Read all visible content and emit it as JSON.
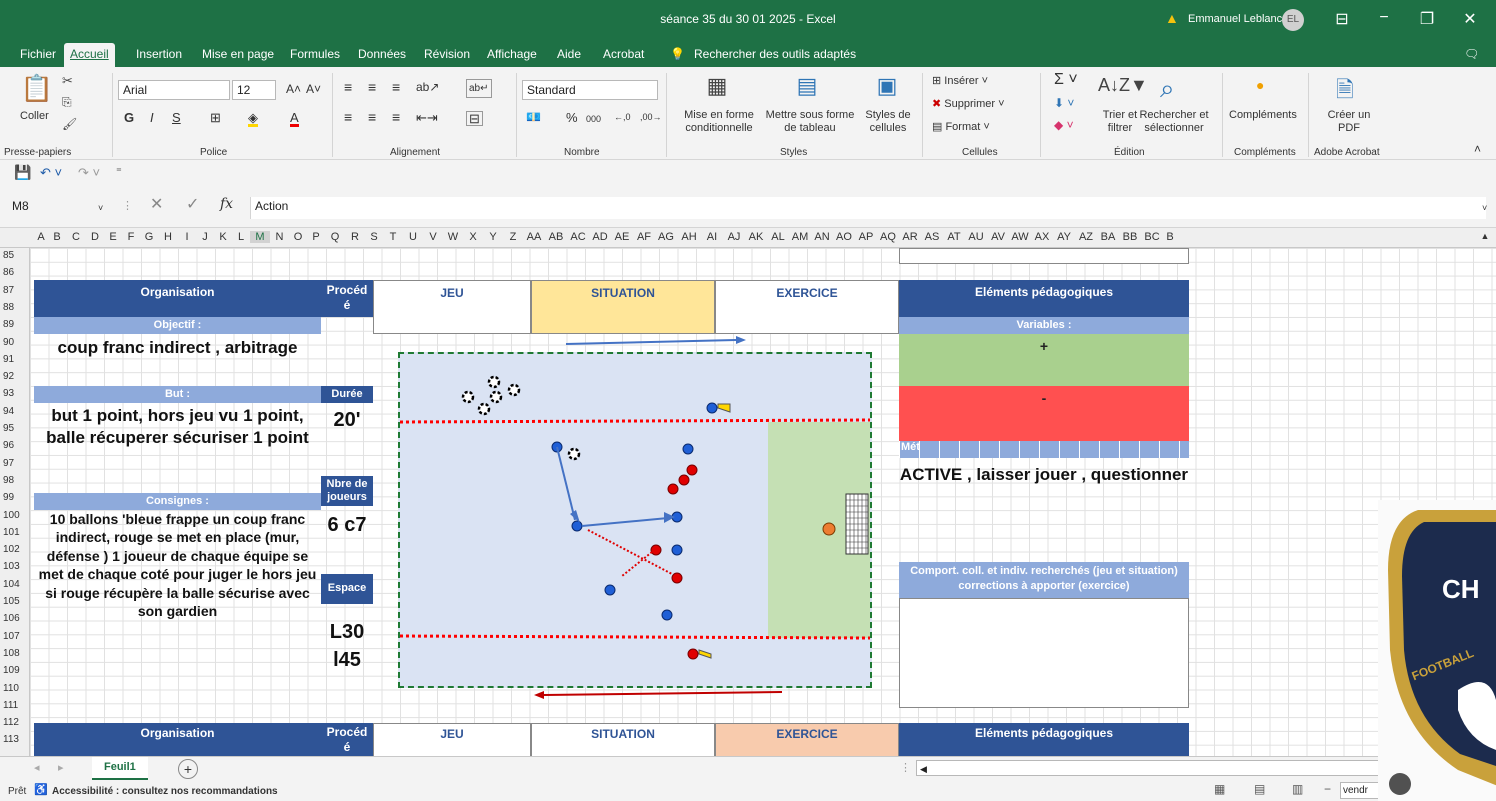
{
  "window": {
    "title": "séance 35 du 30 01 2025  -  Excel",
    "user": "Emmanuel Leblanc",
    "avatar": "EL"
  },
  "menu": {
    "items": [
      "Fichier",
      "Accueil",
      "Insertion",
      "Mise en page",
      "Formules",
      "Données",
      "Révision",
      "Affichage",
      "Aide",
      "Acrobat"
    ],
    "search": "Rechercher des outils adaptés"
  },
  "ribbon": {
    "clipboard": {
      "paste": "Coller",
      "group": "Presse-papiers"
    },
    "font": {
      "name": "Arial",
      "size": "12",
      "group": "Police",
      "bold": "G",
      "italic": "I",
      "underline": "S"
    },
    "alignment": {
      "group": "Alignement"
    },
    "number": {
      "format": "Standard",
      "pct": "%",
      "thousands": "000",
      "group": "Nombre"
    },
    "styles": {
      "conditional": "Mise en forme conditionnelle",
      "table": "Mettre sous forme de tableau",
      "cell": "Styles de cellules",
      "group": "Styles"
    },
    "cells": {
      "insert": "Insérer",
      "delete": "Supprimer",
      "format": "Format",
      "group": "Cellules"
    },
    "edit": {
      "sort": "Trier et filtrer",
      "find": "Rechercher et sélectionner",
      "group": "Édition"
    },
    "addins": {
      "label": "Compléments",
      "group": "Compléments"
    },
    "acrobat": {
      "label": "Créer un PDF",
      "group": "Adobe Acrobat"
    }
  },
  "formula": {
    "cell_ref": "M8",
    "content": "Action",
    "fx": "fx"
  },
  "columns": [
    "A",
    "B",
    "C",
    "D",
    "E",
    "F",
    "G",
    "H",
    "I",
    "J",
    "K",
    "L",
    "M",
    "N",
    "O",
    "P",
    "Q",
    "R",
    "S",
    "T",
    "U",
    "V",
    "W",
    "X",
    "Y",
    "Z",
    "AA",
    "AB",
    "AC",
    "AD",
    "AE",
    "AF",
    "AG",
    "AH",
    "AI",
    "AJ",
    "AK",
    "AL",
    "AM",
    "AN",
    "AO",
    "AP",
    "AQ",
    "AR",
    "AS",
    "AT",
    "AU",
    "AV",
    "AW",
    "AX",
    "AY",
    "AZ",
    "BA",
    "BB",
    "BC",
    "B"
  ],
  "rows": [
    "85",
    "86",
    "87",
    "88",
    "89",
    "90",
    "91",
    "92",
    "93",
    "94",
    "95",
    "96",
    "97",
    "98",
    "99",
    "100",
    "101",
    "102",
    "103",
    "104",
    "105",
    "106",
    "107",
    "108",
    "109",
    "110",
    "111",
    "112",
    "113"
  ],
  "sheet": {
    "organisation": "Organisation",
    "procede": "Procéd é",
    "jeu": "JEU",
    "situation": "SITUATION",
    "exercice": "EXERCICE",
    "elements": "Eléments pédagogiques",
    "objectif_label": "Objectif :",
    "objectif": "coup franc indirect , arbitrage",
    "but_label": "But :",
    "but": "but 1 point, hors jeu vu 1 point, balle récuperer sécuriser 1 point",
    "duree_label": "Durée",
    "duree": "20'",
    "joueurs_label": "Nbre de joueurs",
    "joueurs": "6 c7",
    "espace_label": "Espace",
    "espace": "L30 l45",
    "consignes_label": "Consignes :",
    "consignes": "10 ballons 'bleue frappe un coup franc indirect, rouge se met en place (mur, défense ) 1 joueur de chaque équipe se met de chaque coté pour juger le hors jeu si rouge récupère la balle sécurise avec son gardien",
    "variables_label": "Variables :",
    "plus": "+",
    "minus": "-",
    "met": "Mét",
    "methode": "ACTIVE , laisser jouer , questionner",
    "comport": "Comport.  coll. et indiv. recherchés (jeu et situation) corrections à apporter (exercice)"
  },
  "colors": {
    "excel_green": "#1e7145",
    "header_blue": "#2f5496",
    "light_blue": "#8eaadb",
    "situation": "#ffe699",
    "exercice2": "#f8cbad",
    "plus": "#a9d08e",
    "minus": "#ff5050",
    "pitch": "#dae3f3",
    "goalzone": "#c5e0b4",
    "blue_player": "#1f5fd6",
    "red_player": "#e00000"
  },
  "tabs": {
    "sheet": "Feuil1",
    "add": "+"
  },
  "status": {
    "ready": "Prêt",
    "accessibility": "Accessibilité : consultez nos recommandations",
    "zoom_box": "vendr"
  },
  "logo": {
    "letters": "CH",
    "text": "FOOTBALL"
  }
}
